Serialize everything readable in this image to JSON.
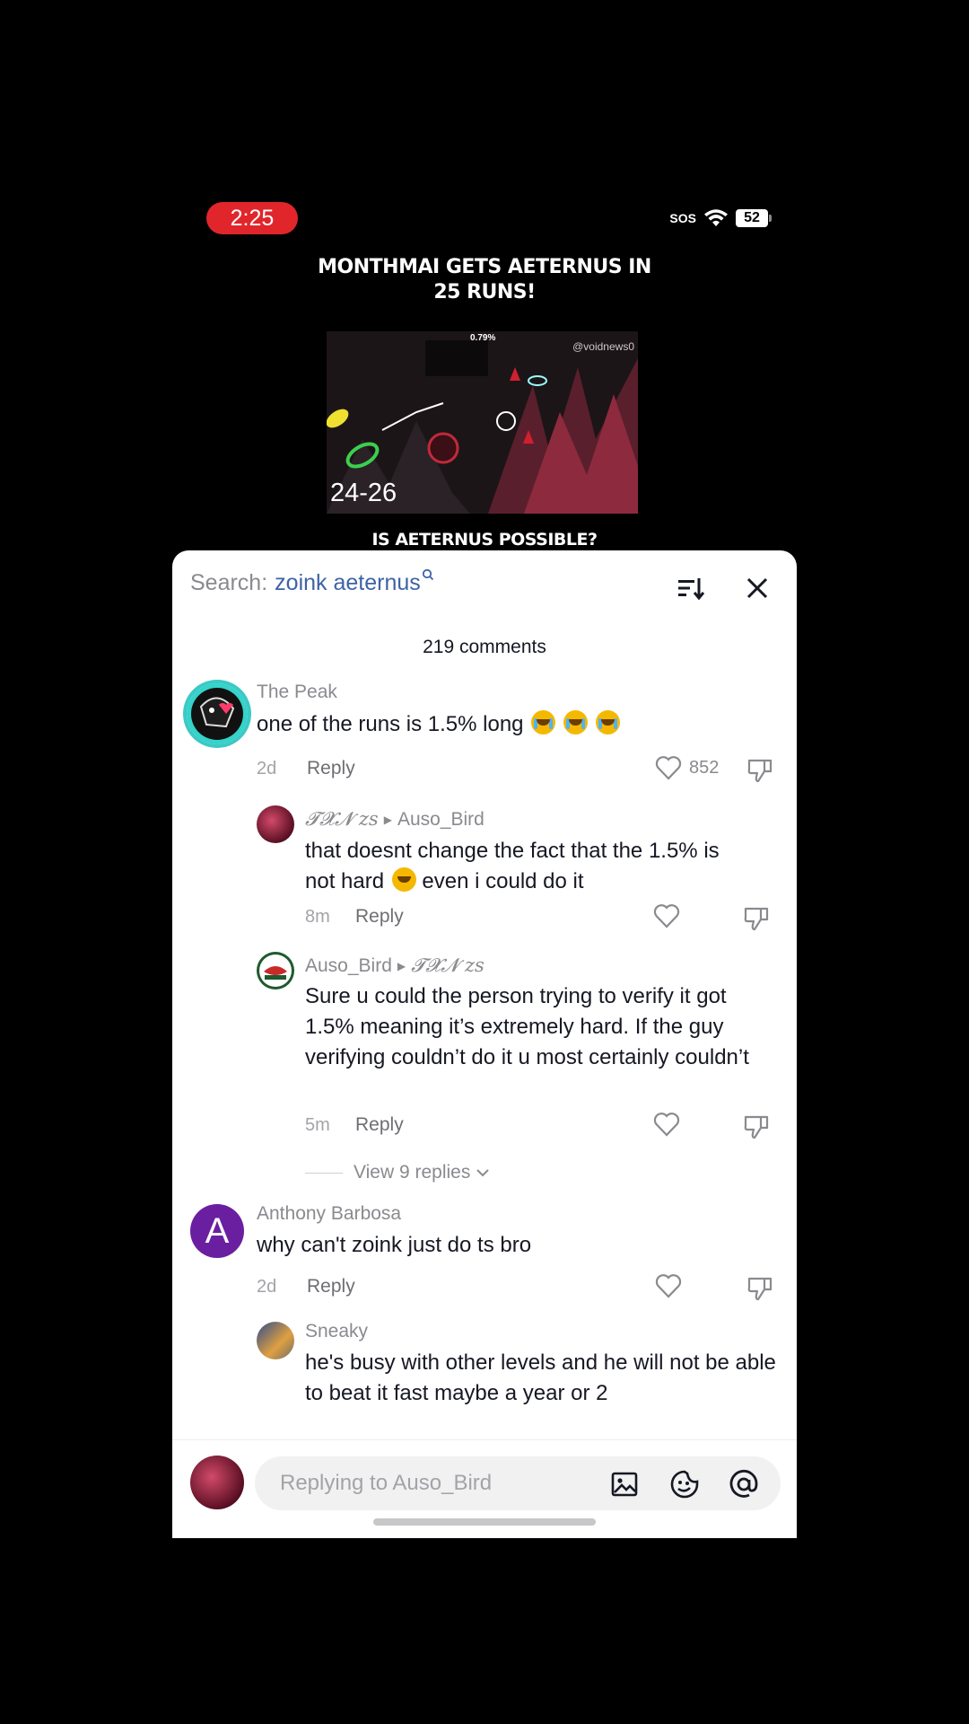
{
  "status": {
    "time": "2:25",
    "sos": "SOS",
    "battery": "52"
  },
  "video": {
    "title_line1": "MONTHMAI GETS AETERNUS IN",
    "title_line2": "25 RUNS!",
    "thumb_percent": "0.79%",
    "thumb_watermark": "@voidnews0",
    "thumb_range": "24-26",
    "question": "IS AETERNUS POSSIBLE?"
  },
  "sheet": {
    "search_label": "Search:",
    "search_query": "zoink aeternus",
    "comment_count": "219 comments",
    "reply_label": "Reply",
    "view_replies": "View 9 replies",
    "input_placeholder": "Replying to Auso_Bird"
  },
  "comments": [
    {
      "user": "The Peak",
      "text": "one of the runs is 1.5% long",
      "time": "2d",
      "likes": "852"
    },
    {
      "user": "𝓣𝓧𝓝 zs",
      "reply_to": "Auso_Bird",
      "text_a": "that doesnt change the fact that the 1.5% is",
      "text_b": "not hard",
      "text_c": "even i could do it",
      "time": "8m"
    },
    {
      "user": "Auso_Bird",
      "reply_to": "𝓣𝓧𝓝 zs",
      "text": "Sure u could the person trying to verify it got 1.5% meaning it’s extremely hard. If the guy verifying couldn’t do it u most certainly couldn’t",
      "time": "5m"
    },
    {
      "user": "Anthony Barbosa",
      "avatar_letter": "A",
      "text": "why can't zoink just do ts bro",
      "time": "2d"
    },
    {
      "user": "Sneaky",
      "text": "he's busy with other levels and he will not be able to beat it fast maybe a year or 2"
    }
  ],
  "colors": {
    "time_pill": "#e0262b",
    "search_query": "#3d63a5",
    "anthony_avatar": "#6a1fa0"
  }
}
